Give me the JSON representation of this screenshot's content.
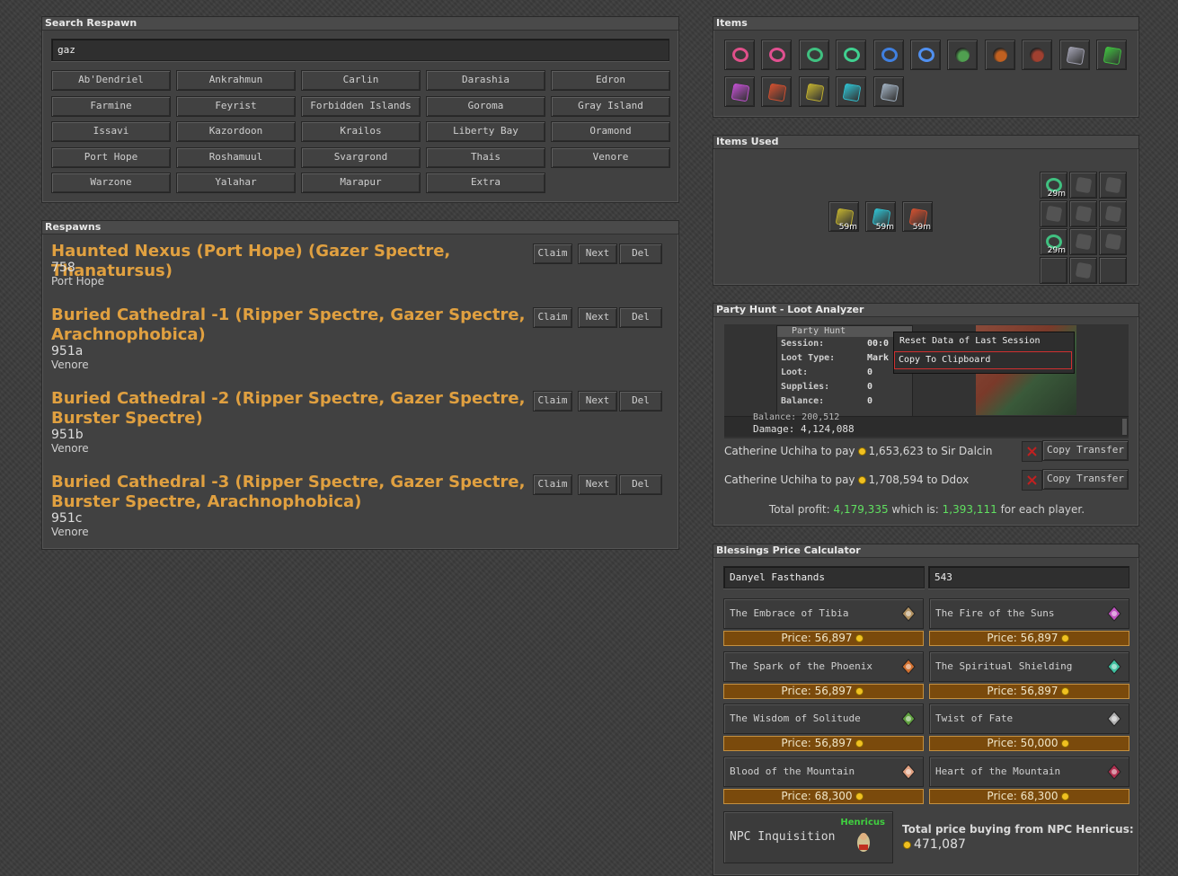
{
  "search_panel": {
    "title": "Search Respawn",
    "query": "gaz",
    "cities": [
      "Ab'Dendriel",
      "Ankrahmun",
      "Carlin",
      "Darashia",
      "Edron",
      "Farmine",
      "Feyrist",
      "Forbidden Islands",
      "Goroma",
      "Gray Island",
      "Issavi",
      "Kazordoon",
      "Krailos",
      "Liberty Bay",
      "Oramond",
      "Port Hope",
      "Roshamuul",
      "Svargrond",
      "Thais",
      "Venore",
      "Warzone",
      "Yalahar",
      "Marapur",
      "Extra"
    ]
  },
  "respawns_panel": {
    "title": "Respawns",
    "claim_label": "Claim",
    "next_label": "Next",
    "del_label": "Del",
    "items": [
      {
        "title": "Haunted Nexus (Port Hope) (Gazer Spectre, Thanatursus)",
        "code": "758",
        "city": "Port Hope"
      },
      {
        "title": "Buried Cathedral -1 (Ripper Spectre, Gazer Spectre, Arachnophobica)",
        "code": "951a",
        "city": "Venore"
      },
      {
        "title": "Buried Cathedral -2 (Ripper Spectre, Gazer Spectre, Burster Spectre)",
        "code": "951b",
        "city": "Venore"
      },
      {
        "title": "Buried Cathedral -3 (Ripper Spectre, Gazer Spectre, Burster Spectre, Arachnophobica)",
        "code": "951c",
        "city": "Venore"
      }
    ]
  },
  "items_panel": {
    "title": "Items",
    "items": [
      {
        "icon": "ring-pink-icon",
        "color": "#e0508a"
      },
      {
        "icon": "ring-pink-glow-icon",
        "color": "#e05090"
      },
      {
        "icon": "ring-green-icon",
        "color": "#40c080"
      },
      {
        "icon": "ring-green-glow-icon",
        "color": "#40d090"
      },
      {
        "icon": "ring-blue-icon",
        "color": "#4080e0"
      },
      {
        "icon": "ring-blue-glow-icon",
        "color": "#5090f0"
      },
      {
        "icon": "amulet-green-icon",
        "color": "#50a050"
      },
      {
        "icon": "amulet-orange-icon",
        "color": "#c06020"
      },
      {
        "icon": "amulet-red-icon",
        "color": "#a04030"
      },
      {
        "icon": "charm-grey-icon",
        "color": "#a0a0b0"
      },
      {
        "icon": "charm-green-icon",
        "color": "#40c040"
      },
      {
        "icon": "charm-purple-icon",
        "color": "#c050d0"
      },
      {
        "icon": "charm-red-icon",
        "color": "#d05030"
      },
      {
        "icon": "charm-yellow-icon",
        "color": "#c0b030"
      },
      {
        "icon": "charm-cyan-icon",
        "color": "#30c0d0"
      },
      {
        "icon": "charm-silver-icon",
        "color": "#a0b0c0"
      }
    ]
  },
  "items_used_panel": {
    "title": "Items Used",
    "used": [
      {
        "icon": "charm-yellow-icon",
        "color": "#c0b030",
        "time": "59m"
      },
      {
        "icon": "charm-cyan-icon",
        "color": "#30c0d0",
        "time": "59m"
      },
      {
        "icon": "charm-red-icon",
        "color": "#d05030",
        "time": "59m"
      }
    ],
    "equipment": [
      {
        "icon": "ring-green-icon",
        "time": "29m"
      },
      {
        "icon": "helmet-icon",
        "time": ""
      },
      {
        "icon": "backpack-icon",
        "time": ""
      },
      {
        "icon": "sword-icon",
        "time": ""
      },
      {
        "icon": "armor-icon",
        "time": ""
      },
      {
        "icon": "shield-icon",
        "time": ""
      },
      {
        "icon": "ring-green-icon",
        "time": "29m"
      },
      {
        "icon": "legs-icon",
        "time": ""
      },
      {
        "icon": "axe-icon",
        "time": ""
      },
      {
        "icon": "empty-slot-icon",
        "time": ""
      },
      {
        "icon": "boots-icon",
        "time": ""
      },
      {
        "icon": "empty-slot-icon",
        "time": ""
      }
    ]
  },
  "party_panel": {
    "title": "Party Hunt - Loot Analyzer",
    "overlay": {
      "window_title": "Party Hunt",
      "rows": [
        {
          "label": "Session:",
          "value": "00:0"
        },
        {
          "label": "Loot Type:",
          "value": "Mark"
        },
        {
          "label": "Loot:",
          "value": "0"
        },
        {
          "label": "Supplies:",
          "value": "0"
        },
        {
          "label": "Balance:",
          "value": "0"
        }
      ],
      "menu": [
        "Reset Data of Last Session",
        "Copy To Clipboard"
      ],
      "balance_partial": "Balance:   200,512",
      "damage": "Damage: 4,124,088"
    },
    "transfers": [
      {
        "from": "Catherine Uchiha to pay",
        "amount": "1,653,623",
        "to": "to Sir Dalcin",
        "button": "Copy Transfer"
      },
      {
        "from": "Catherine Uchiha to pay",
        "amount": "1,708,594",
        "to": "to Ddox",
        "button": "Copy Transfer"
      }
    ],
    "total_label": "Total profit:",
    "total_value": "4,179,335",
    "which_is": "which is:",
    "per_player": "1,393,111",
    "for_each": "for each player."
  },
  "blessings_panel": {
    "title": "Blessings Price Calculator",
    "name_value": "Danyel Fasthands",
    "level_value": "543",
    "price_prefix": "Price:",
    "blessings": [
      {
        "name": "The Embrace of Tibia",
        "price": "56,897",
        "icon": "embrace-icon"
      },
      {
        "name": "The Fire of the Suns",
        "price": "56,897",
        "icon": "fire-suns-icon"
      },
      {
        "name": "The Spark of the Phoenix",
        "price": "56,897",
        "icon": "phoenix-icon"
      },
      {
        "name": "The Spiritual Shielding",
        "price": "56,897",
        "icon": "spiritual-shield-icon"
      },
      {
        "name": "The Wisdom of Solitude",
        "price": "56,897",
        "icon": "wisdom-icon"
      },
      {
        "name": "Twist of Fate",
        "price": "50,000",
        "icon": "twist-fate-icon"
      },
      {
        "name": "Blood of the Mountain",
        "price": "68,300",
        "icon": "blood-mountain-icon"
      },
      {
        "name": "Heart of the Mountain",
        "price": "68,300",
        "icon": "heart-mountain-icon"
      }
    ],
    "npc_label": "NPC Inquisition",
    "npc_name": "Henricus",
    "total_label": "Total price buying from NPC Henricus:",
    "total_value": "471,087"
  }
}
